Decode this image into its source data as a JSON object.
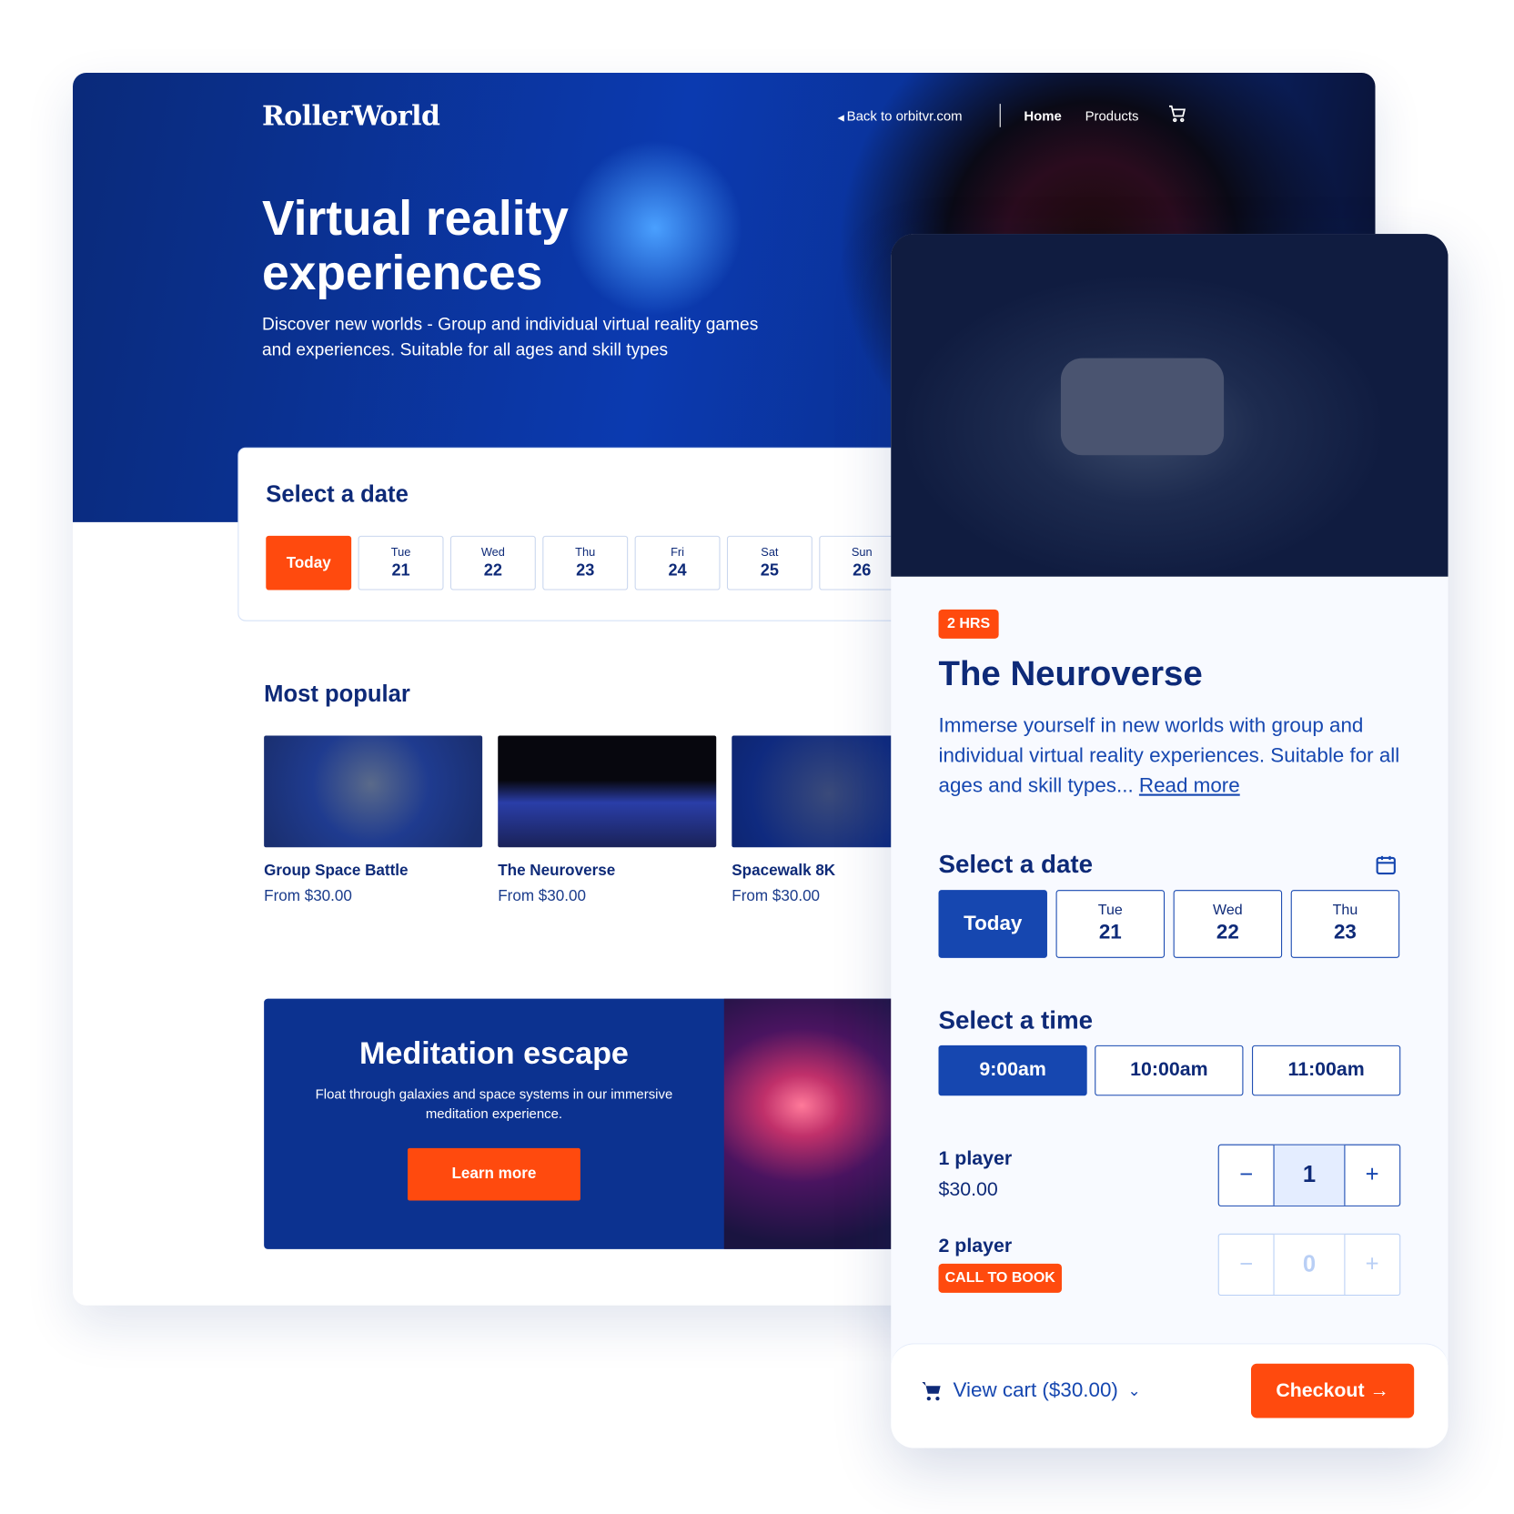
{
  "header": {
    "logo": "RollerWorld",
    "back_link": "Back to orbitvr.com",
    "nav": [
      "Home",
      "Products"
    ],
    "cart_icon": "cart-icon"
  },
  "hero": {
    "title": "Virtual reality experiences",
    "subtitle": "Discover new worlds - Group and individual virtual reality games and experiences. Suitable for all ages and skill types"
  },
  "date_picker": {
    "title": "Select a date",
    "dates": [
      {
        "label": "Today"
      },
      {
        "day": "Tue",
        "num": "21"
      },
      {
        "day": "Wed",
        "num": "22"
      },
      {
        "day": "Thu",
        "num": "23"
      },
      {
        "day": "Fri",
        "num": "24"
      },
      {
        "day": "Sat",
        "num": "25"
      },
      {
        "day": "Sun",
        "num": "26"
      }
    ]
  },
  "popular": {
    "title": "Most popular",
    "items": [
      {
        "name": "Group Space Battle",
        "price": "From $30.00"
      },
      {
        "name": "The Neuroverse",
        "price": "From $30.00"
      },
      {
        "name": "Spacewalk 8K",
        "price": "From $30.00"
      }
    ]
  },
  "banner": {
    "title": "Meditation escape",
    "text": "Float through galaxies and space systems in our immersive meditation experience.",
    "button": "Learn more"
  },
  "product": {
    "badge": "2 HRS",
    "title": "The Neuroverse",
    "description": "Immerse yourself in new worlds with group and individual virtual reality experiences. Suitable for all ages and skill types...",
    "read_more": "Read more",
    "date_title": "Select a date",
    "dates": [
      {
        "label": "Today"
      },
      {
        "day": "Tue",
        "num": "21"
      },
      {
        "day": "Wed",
        "num": "22"
      },
      {
        "day": "Thu",
        "num": "23"
      }
    ],
    "time_title": "Select a time",
    "times": [
      "9:00am",
      "10:00am",
      "11:00am"
    ],
    "selected_time": "9:00am",
    "tickets": [
      {
        "name": "1 player",
        "price": "$30.00",
        "qty": "1"
      },
      {
        "name": "2 player",
        "tag": "CALL TO BOOK",
        "qty": "0"
      }
    ],
    "cart": "View cart ($30.00)",
    "checkout": "Checkout"
  },
  "colors": {
    "accent": "#ff4a0e",
    "navy": "#0e2a78",
    "primary": "#1647b0"
  }
}
